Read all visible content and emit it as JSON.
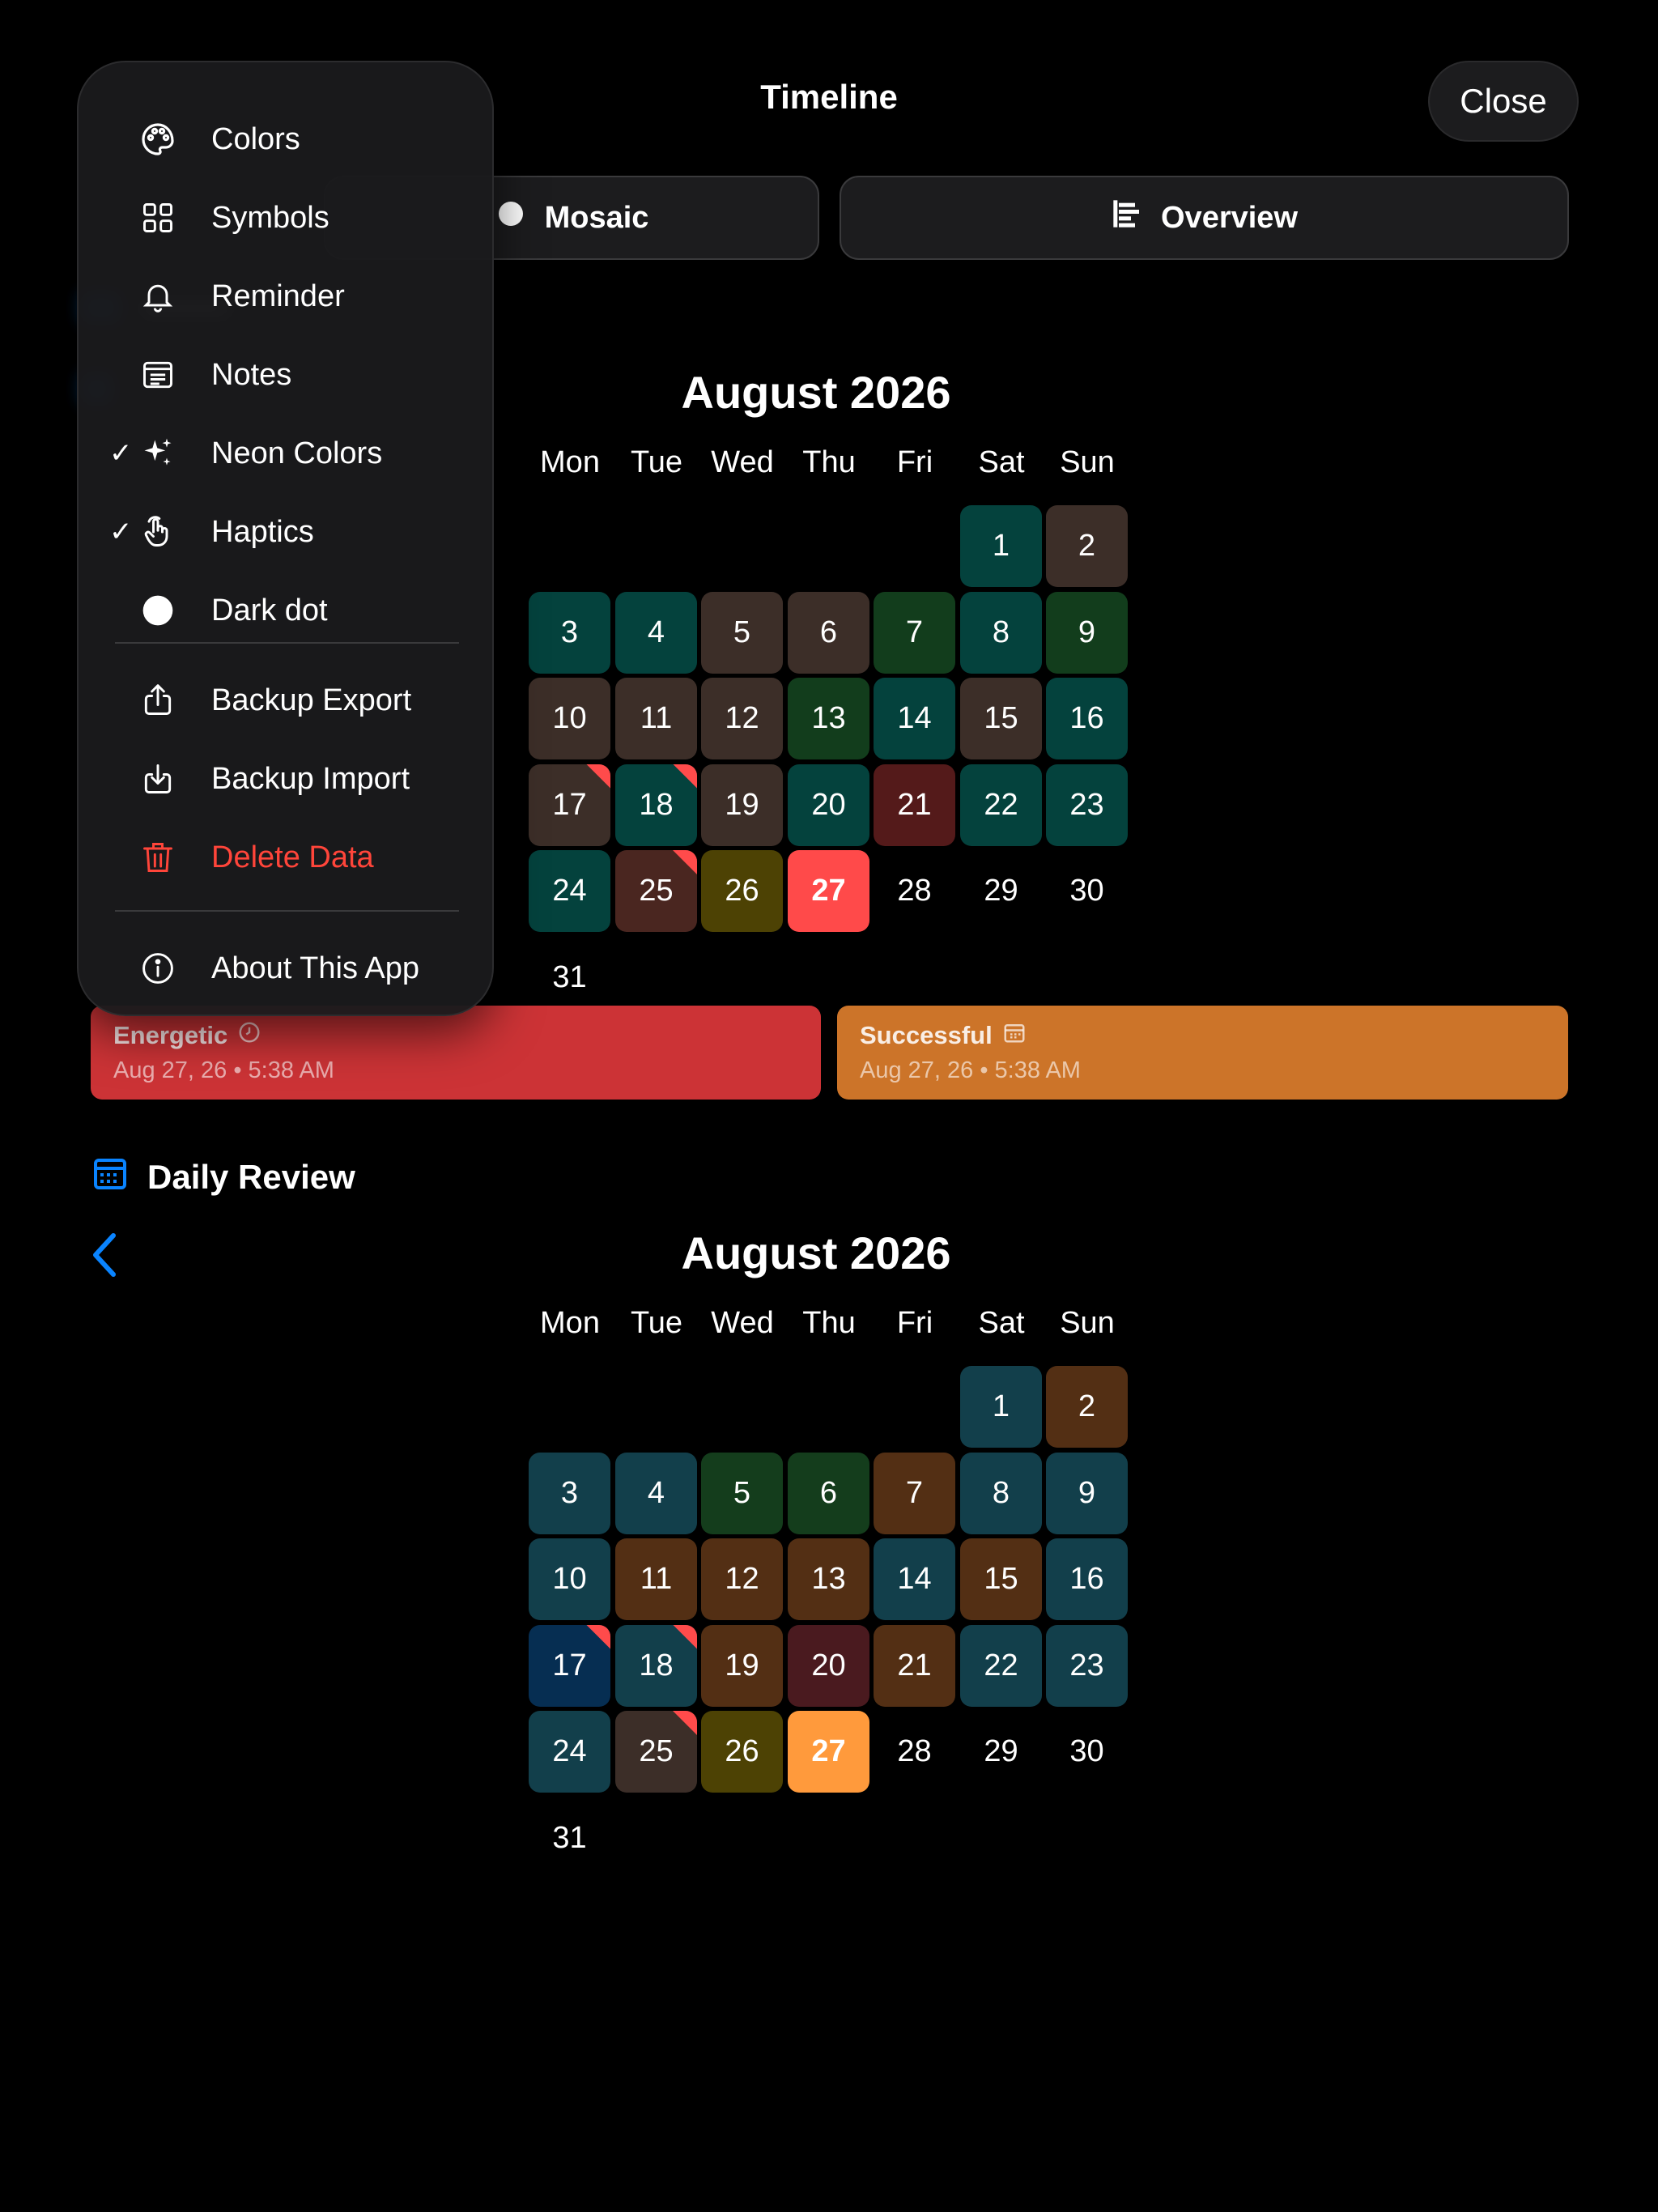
{
  "header": {
    "title": "Timeline",
    "close_label": "Close"
  },
  "segments": [
    {
      "label": "Mosaic",
      "selected": false
    },
    {
      "label": "Overview",
      "selected": true
    }
  ],
  "timeline": {
    "month_title": "August 2026",
    "weekdays": [
      "Mon",
      "Tue",
      "Wed",
      "Thu",
      "Fri",
      "Sat",
      "Sun"
    ],
    "days": [
      {
        "day": "1",
        "color": "#04423d"
      },
      {
        "day": "2",
        "color": "#3c2e28"
      },
      {
        "day": "3",
        "color": "#04423d"
      },
      {
        "day": "4",
        "color": "#04423d"
      },
      {
        "day": "5",
        "color": "#3c2e28"
      },
      {
        "day": "6",
        "color": "#3c2e28"
      },
      {
        "day": "7",
        "color": "#123d1c"
      },
      {
        "day": "8",
        "color": "#04423d"
      },
      {
        "day": "9",
        "color": "#123d1c"
      },
      {
        "day": "10",
        "color": "#3c2e28"
      },
      {
        "day": "11",
        "color": "#3c2e28"
      },
      {
        "day": "12",
        "color": "#3c2e28"
      },
      {
        "day": "13",
        "color": "#123d1c"
      },
      {
        "day": "14",
        "color": "#04423d"
      },
      {
        "day": "15",
        "color": "#3c2e28"
      },
      {
        "day": "16",
        "color": "#04423d"
      },
      {
        "day": "17",
        "color": "#3c2e28",
        "flag": true
      },
      {
        "day": "18",
        "color": "#04423d",
        "flag": true
      },
      {
        "day": "19",
        "color": "#3c2e28"
      },
      {
        "day": "20",
        "color": "#04423d"
      },
      {
        "day": "21",
        "color": "#541a1a"
      },
      {
        "day": "22",
        "color": "#04423d"
      },
      {
        "day": "23",
        "color": "#04423d"
      },
      {
        "day": "24",
        "color": "#04423d"
      },
      {
        "day": "25",
        "color": "#4a2620",
        "flag": true
      },
      {
        "day": "26",
        "color": "#4d4204"
      },
      {
        "day": "27",
        "color": "#ff4a4a",
        "today": true
      },
      {
        "day": "28"
      },
      {
        "day": "29"
      },
      {
        "day": "30"
      },
      {
        "day": "31"
      }
    ]
  },
  "entries": [
    {
      "name": "Energetic",
      "icon": "clock-icon",
      "meta": "Aug 27, 26 • 5:38 AM",
      "color": "#cc3336"
    },
    {
      "name": "Successful",
      "icon": "calendar-icon",
      "meta": "Aug 27, 26 • 5:38 AM",
      "color": "#cc7429"
    }
  ],
  "daily_review": {
    "section_title": "Daily Review",
    "month_title": "August 2026",
    "weekdays": [
      "Mon",
      "Tue",
      "Wed",
      "Thu",
      "Fri",
      "Sat",
      "Sun"
    ],
    "days": [
      {
        "day": "1",
        "color": "#123f4b"
      },
      {
        "day": "2",
        "color": "#532f14"
      },
      {
        "day": "3",
        "color": "#123f4b"
      },
      {
        "day": "4",
        "color": "#123f4b"
      },
      {
        "day": "5",
        "color": "#143d1c"
      },
      {
        "day": "6",
        "color": "#143d1c"
      },
      {
        "day": "7",
        "color": "#532f14"
      },
      {
        "day": "8",
        "color": "#123f4b"
      },
      {
        "day": "9",
        "color": "#123f4b"
      },
      {
        "day": "10",
        "color": "#123f4b"
      },
      {
        "day": "11",
        "color": "#532f14"
      },
      {
        "day": "12",
        "color": "#532f14"
      },
      {
        "day": "13",
        "color": "#532f14"
      },
      {
        "day": "14",
        "color": "#123f4b"
      },
      {
        "day": "15",
        "color": "#532f14"
      },
      {
        "day": "16",
        "color": "#123f4b"
      },
      {
        "day": "17",
        "color": "#062e52",
        "flag": true
      },
      {
        "day": "18",
        "color": "#123f4b",
        "flag": true
      },
      {
        "day": "19",
        "color": "#532f14"
      },
      {
        "day": "20",
        "color": "#4a1a1f"
      },
      {
        "day": "21",
        "color": "#532f14"
      },
      {
        "day": "22",
        "color": "#123f4b"
      },
      {
        "day": "23",
        "color": "#123f4b"
      },
      {
        "day": "24",
        "color": "#123f4b"
      },
      {
        "day": "25",
        "color": "#3c2e28",
        "flag": true
      },
      {
        "day": "26",
        "color": "#4d4204"
      },
      {
        "day": "27",
        "color": "#ff9a3c",
        "today": true
      },
      {
        "day": "28"
      },
      {
        "day": "29"
      },
      {
        "day": "30"
      },
      {
        "day": "31"
      }
    ]
  },
  "menu": {
    "items": [
      {
        "label": "Colors",
        "icon": "palette-icon",
        "checked": false
      },
      {
        "label": "Symbols",
        "icon": "grid-icon",
        "checked": false
      },
      {
        "label": "Reminder",
        "icon": "bell-icon",
        "checked": false
      },
      {
        "label": "Notes",
        "icon": "notes-icon",
        "checked": false
      },
      {
        "label": "Neon Colors",
        "icon": "sparkles-icon",
        "checked": true
      },
      {
        "label": "Haptics",
        "icon": "hand-tap-icon",
        "checked": true
      },
      {
        "label": "Dark dot",
        "icon": "dot-icon",
        "checked": false
      },
      {
        "label": "Backup Export",
        "icon": "share-icon",
        "checked": false
      },
      {
        "label": "Backup Import",
        "icon": "import-icon",
        "checked": false
      },
      {
        "label": "Delete Data",
        "icon": "trash-icon",
        "checked": false,
        "destructive": true
      },
      {
        "label": "About This App",
        "icon": "info-icon",
        "checked": false
      }
    ],
    "check_glyph": "✓"
  },
  "colors": {
    "accent": "#0a84ff",
    "destructive": "#ff453a"
  }
}
